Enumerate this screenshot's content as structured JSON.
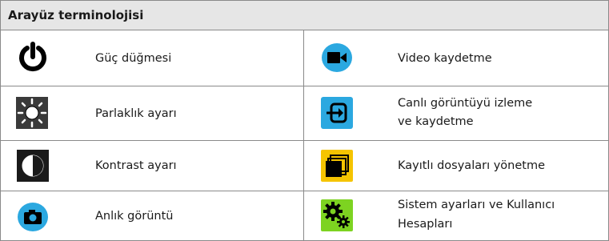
{
  "title": "Arayüz terminolojisi",
  "rows": [
    {
      "left": {
        "icon": "power-icon",
        "label": "Güç düğmesi"
      },
      "right": {
        "icon": "video-camera-icon",
        "label": "Video kaydetme"
      }
    },
    {
      "left": {
        "icon": "brightness-icon",
        "label": "Parlaklık ayarı"
      },
      "right": {
        "icon": "live-input-icon",
        "label_line1": "Canlı görüntüyü izleme",
        "label_line2": "ve kaydetme"
      }
    },
    {
      "left": {
        "icon": "contrast-icon",
        "label": "Kontrast ayarı"
      },
      "right": {
        "icon": "folders-icon",
        "label": "Kayıtlı dosyaları yönetme"
      }
    },
    {
      "left": {
        "icon": "photo-camera-icon",
        "label": "Anlık görüntü"
      },
      "right": {
        "icon": "gears-icon",
        "label_line1": "Sistem ayarları ve Kullanıcı",
        "label_line2": "Hesapları"
      }
    }
  ],
  "colors": {
    "header_bg": "#e6e6e6",
    "border": "#8a8a8a",
    "blue_icon": "#2ba8e0",
    "yellow_icon": "#f5c400",
    "green_icon": "#7dd321",
    "dark_icon": "#1a1a1a"
  }
}
